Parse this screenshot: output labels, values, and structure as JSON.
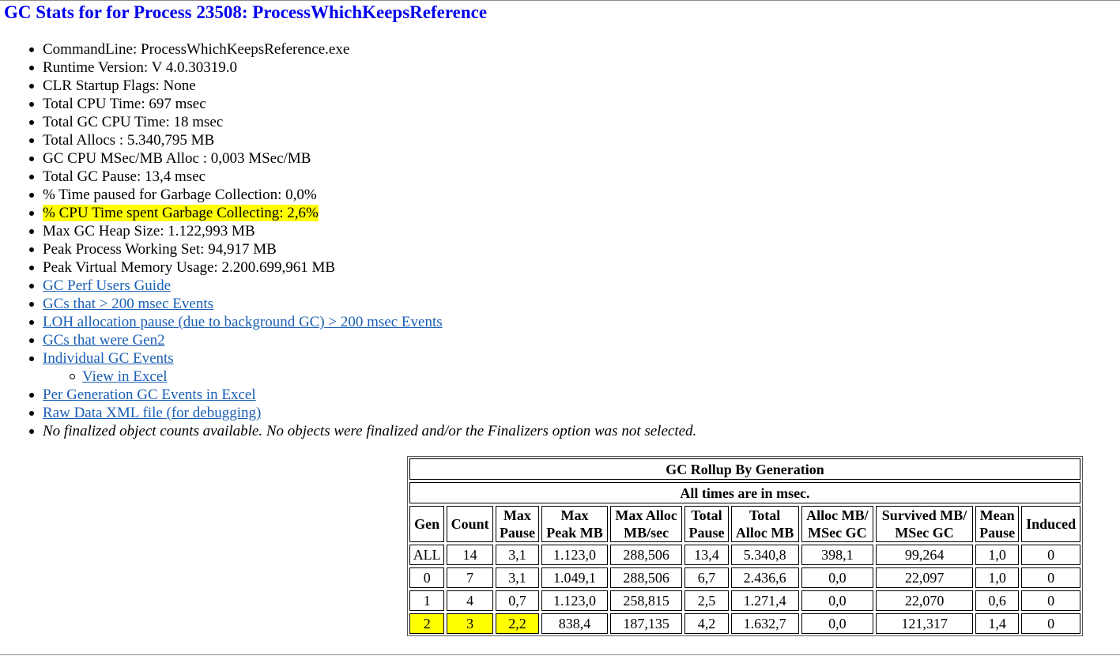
{
  "page": {
    "title": "GC Stats for for Process 23508: ProcessWhichKeepsReference"
  },
  "stats": {
    "command_line": "CommandLine: ProcessWhichKeepsReference.exe",
    "runtime_version": "Runtime Version: V 4.0.30319.0",
    "clr_flags": "CLR Startup Flags: None",
    "total_cpu": "Total CPU Time: 697 msec",
    "total_gc_cpu": "Total GC CPU Time: 18 msec",
    "total_allocs": "Total Allocs : 5.340,795 MB",
    "gc_cpu_per_mb": "GC CPU MSec/MB Alloc : 0,003 MSec/MB",
    "total_gc_pause": "Total GC Pause: 13,4 msec",
    "time_paused": "% Time paused for Garbage Collection: 0,0%",
    "cpu_time_gc": "% CPU Time spent Garbage Collecting: 2,6%",
    "max_heap": "Max GC Heap Size: 1.122,993 MB",
    "peak_working_set": "Peak Process Working Set: 94,917 MB",
    "peak_virtual": "Peak Virtual Memory Usage: 2.200.699,961 MB"
  },
  "links": {
    "users_guide": "GC Perf Users Guide",
    "gcs_200": "GCs that > 200 msec Events",
    "loh_pause": "LOH allocation pause (due to background GC) > 200 msec Events",
    "gen2": "GCs that were Gen2",
    "individual": "Individual GC Events",
    "view_excel": "View in Excel",
    "per_gen_excel": "Per Generation GC Events in Excel",
    "raw_xml": "Raw Data XML file (for debugging)"
  },
  "note": "No finalized object counts available. No objects were finalized and/or the Finalizers option was not selected.",
  "rollup": {
    "caption": "GC Rollup By Generation",
    "subcaption": "All times are in msec.",
    "headers": {
      "gen": "Gen",
      "count": "Count",
      "max_pause_1": "Max",
      "max_pause_2": "Pause",
      "max_peak_1": "Max",
      "max_peak_2": "Peak MB",
      "max_alloc_1": "Max Alloc",
      "max_alloc_2": "MB/sec",
      "total_pause_1": "Total",
      "total_pause_2": "Pause",
      "total_alloc_1": "Total",
      "total_alloc_2": "Alloc MB",
      "alloc_msec_1": "Alloc MB/",
      "alloc_msec_2": "MSec GC",
      "survived_1": "Survived MB/",
      "survived_2": "MSec GC",
      "mean_pause_1": "Mean",
      "mean_pause_2": "Pause",
      "induced": "Induced"
    },
    "rows": [
      [
        "ALL",
        "14",
        "3,1",
        "1.123,0",
        "288,506",
        "13,4",
        "5.340,8",
        "398,1",
        "99,264",
        "1,0",
        "0"
      ],
      [
        "0",
        "7",
        "3,1",
        "1.049,1",
        "288,506",
        "6,7",
        "2.436,6",
        "0,0",
        "22,097",
        "1,0",
        "0"
      ],
      [
        "1",
        "4",
        "0,7",
        "1.123,0",
        "258,815",
        "2,5",
        "1.271,4",
        "0,0",
        "22,070",
        "0,6",
        "0"
      ],
      [
        "2",
        "3",
        "2,2",
        "838,4",
        "187,135",
        "4,2",
        "1.632,7",
        "0,0",
        "121,317",
        "1,4",
        "0"
      ]
    ]
  },
  "colors": {
    "title": "#0000ee",
    "link": "#1a5fb4",
    "highlight": "#ffff00"
  }
}
